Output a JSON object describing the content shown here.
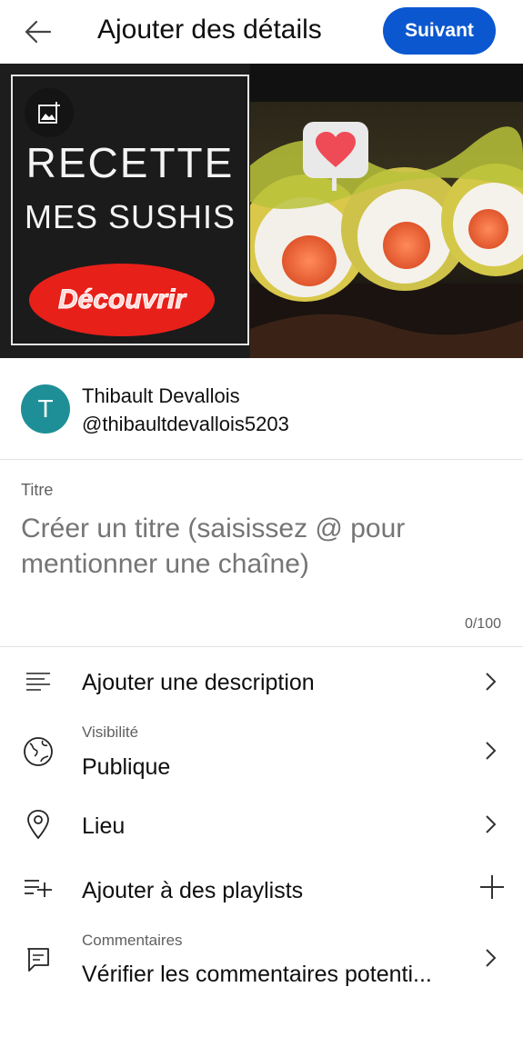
{
  "header": {
    "title": "Ajouter des détails",
    "next_label": "Suivant"
  },
  "thumbnail": {
    "line1": "RECETTE",
    "line2": "MES SUSHIS",
    "cta": "Découvrir"
  },
  "channel": {
    "avatar_letter": "T",
    "name": "Thibault Devallois",
    "handle": "@thibaultdevallois5203",
    "avatar_color": "#1e8f96"
  },
  "title_field": {
    "label": "Titre",
    "placeholder": "Créer un titre (saisissez @ pour mentionner une chaîne)",
    "counter": "0/100"
  },
  "options": {
    "description": {
      "label": "Ajouter une description",
      "icon": "description-lines-icon"
    },
    "visibility": {
      "caption": "Visibilité",
      "value": "Publique",
      "icon": "globe-icon"
    },
    "location": {
      "label": "Lieu",
      "icon": "location-pin-icon"
    },
    "playlists": {
      "label": "Ajouter à des playlists",
      "icon": "playlist-add-icon"
    },
    "comments": {
      "caption": "Commentaires",
      "value": "Vérifier les commentaires potenti...",
      "icon": "comment-icon"
    }
  },
  "colors": {
    "accent": "#0b57d0",
    "cta_red": "#e8201a"
  }
}
